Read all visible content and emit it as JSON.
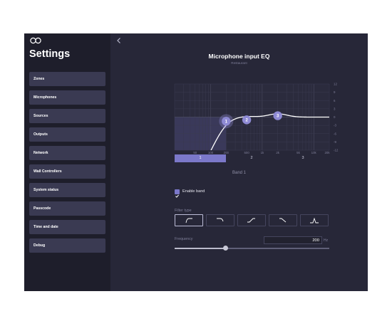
{
  "sidebar": {
    "title": "Settings",
    "items": [
      {
        "label": "Zones"
      },
      {
        "label": "Microphones"
      },
      {
        "label": "Sources"
      },
      {
        "label": "Outputs"
      },
      {
        "label": "Network"
      },
      {
        "label": "Wall Controllers"
      },
      {
        "label": "System status"
      },
      {
        "label": "Passcode"
      },
      {
        "label": "Time and date"
      },
      {
        "label": "Debug"
      }
    ]
  },
  "header": {
    "title": "Microphone input EQ",
    "subtitle": "Restaurant"
  },
  "eq": {
    "db_ticks": [
      "12",
      "9",
      "6",
      "3",
      "0",
      "-3",
      "-6",
      "-9",
      "-12"
    ],
    "freq_ticks": [
      "50",
      "100",
      "200",
      "500",
      "1k",
      "2k",
      "5k",
      "10k",
      "20k"
    ],
    "handles": [
      {
        "label": "1",
        "freq_hz": 200,
        "gain_db": -1.5
      },
      {
        "label": "2",
        "freq_hz": 500,
        "gain_db": -1
      },
      {
        "label": "3",
        "freq_hz": 2000,
        "gain_db": 0.5
      }
    ],
    "curve_color": "#ffffff",
    "handle_color": "#8e8ad4",
    "highlight_color": "#7b78c9"
  },
  "band_tabs": [
    {
      "label": "1",
      "active": true
    },
    {
      "label": "2",
      "active": false
    },
    {
      "label": "3",
      "active": false
    }
  ],
  "band_title": "Band 1",
  "enable_band": {
    "label": "Enable band",
    "checked": true
  },
  "filter": {
    "label": "Filter type",
    "options": [
      "high-pass-icon",
      "low-shelf-icon",
      "high-shelf-icon",
      "low-pass-icon",
      "peak-icon"
    ],
    "selected": 0
  },
  "frequency": {
    "label": "Frequency",
    "value": "200",
    "unit": "Hz",
    "slider_fraction": 0.33
  }
}
